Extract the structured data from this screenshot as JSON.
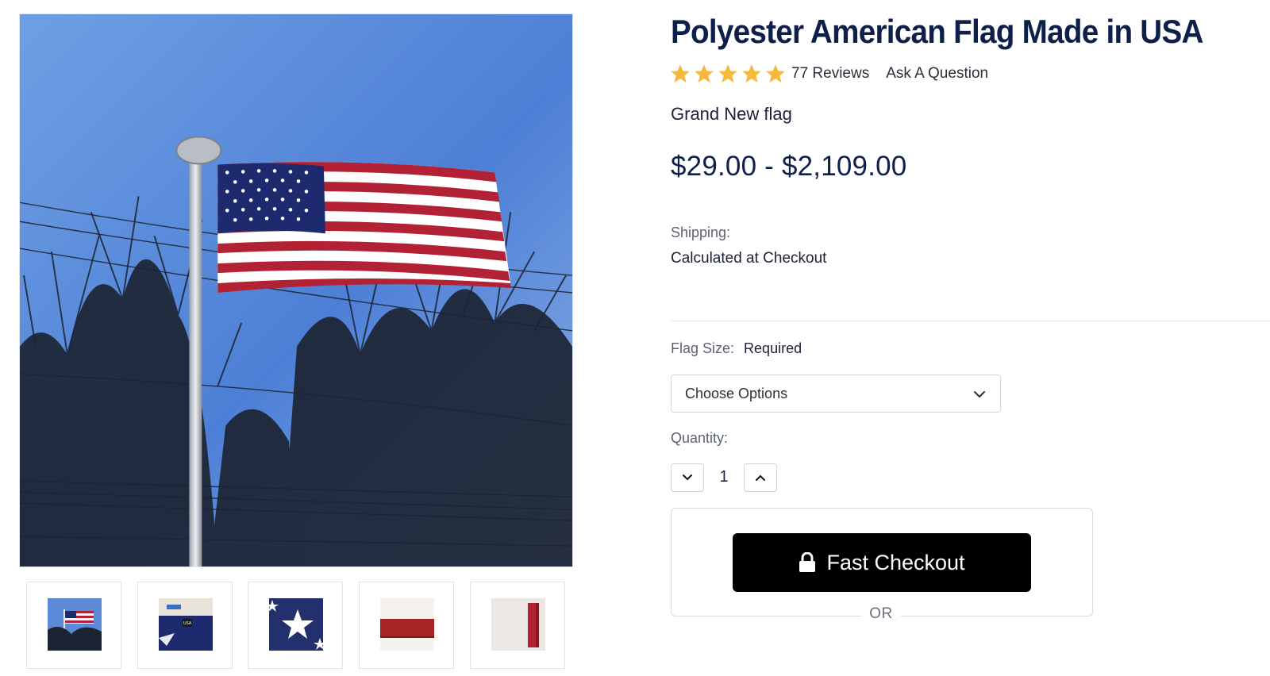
{
  "gallery": {
    "main_image_alt": "American flag flying on a flagpole against blue sky with bare trees",
    "thumbnails": [
      {
        "name": "flag-on-pole"
      },
      {
        "name": "flag-label-usa"
      },
      {
        "name": "flag-star-closeup"
      },
      {
        "name": "flag-stripe-closeup"
      },
      {
        "name": "flag-edge-closeup"
      }
    ]
  },
  "product": {
    "title": "Polyester American Flag Made in USA",
    "rating": 5,
    "reviews_label": "77 Reviews",
    "ask_label": "Ask A Question",
    "subtitle": "Grand New flag",
    "price": "$29.00 - $2,109.00",
    "shipping_label": "Shipping:",
    "shipping_value": "Calculated at Checkout",
    "flag_size_label": "Flag Size:",
    "flag_size_required": "Required",
    "select_value": "Choose Options",
    "quantity_label": "Quantity:",
    "quantity_value": "1",
    "fast_checkout_label": "Fast Checkout",
    "or_label": "OR"
  },
  "colors": {
    "star": "#f6b93b",
    "title": "#0f1f4b",
    "checkout_bg": "#000000"
  }
}
